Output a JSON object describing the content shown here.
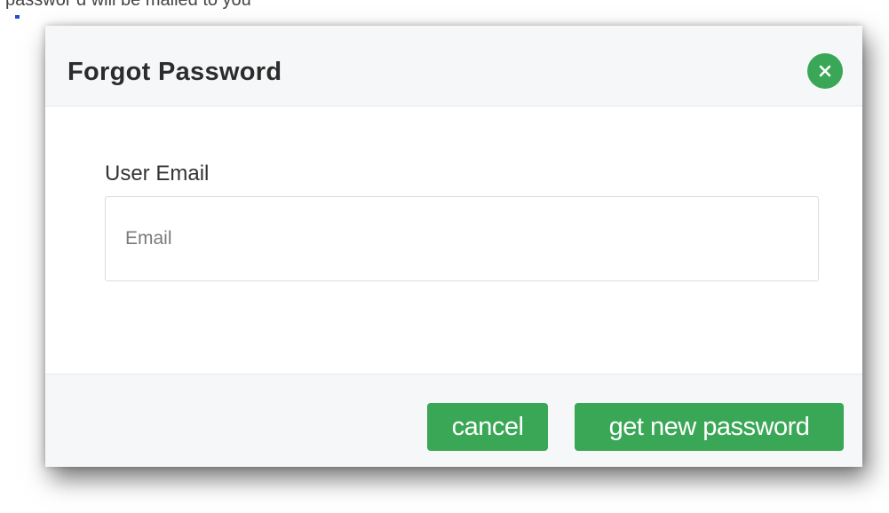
{
  "top_fragment_text": "passwor d will be mailed to you",
  "dialog": {
    "title": "Forgot Password",
    "close_icon": "close-circle-icon"
  },
  "form": {
    "email_label": "User Email",
    "email_placeholder": "Email",
    "email_value": ""
  },
  "footer": {
    "cancel_label": "cancel",
    "submit_label": "get new password"
  },
  "colors": {
    "accent": "#3aa757",
    "header_bg": "#f6f7f8",
    "title_text": "#2c2c2c",
    "link_blue": "#1f4fd8"
  }
}
